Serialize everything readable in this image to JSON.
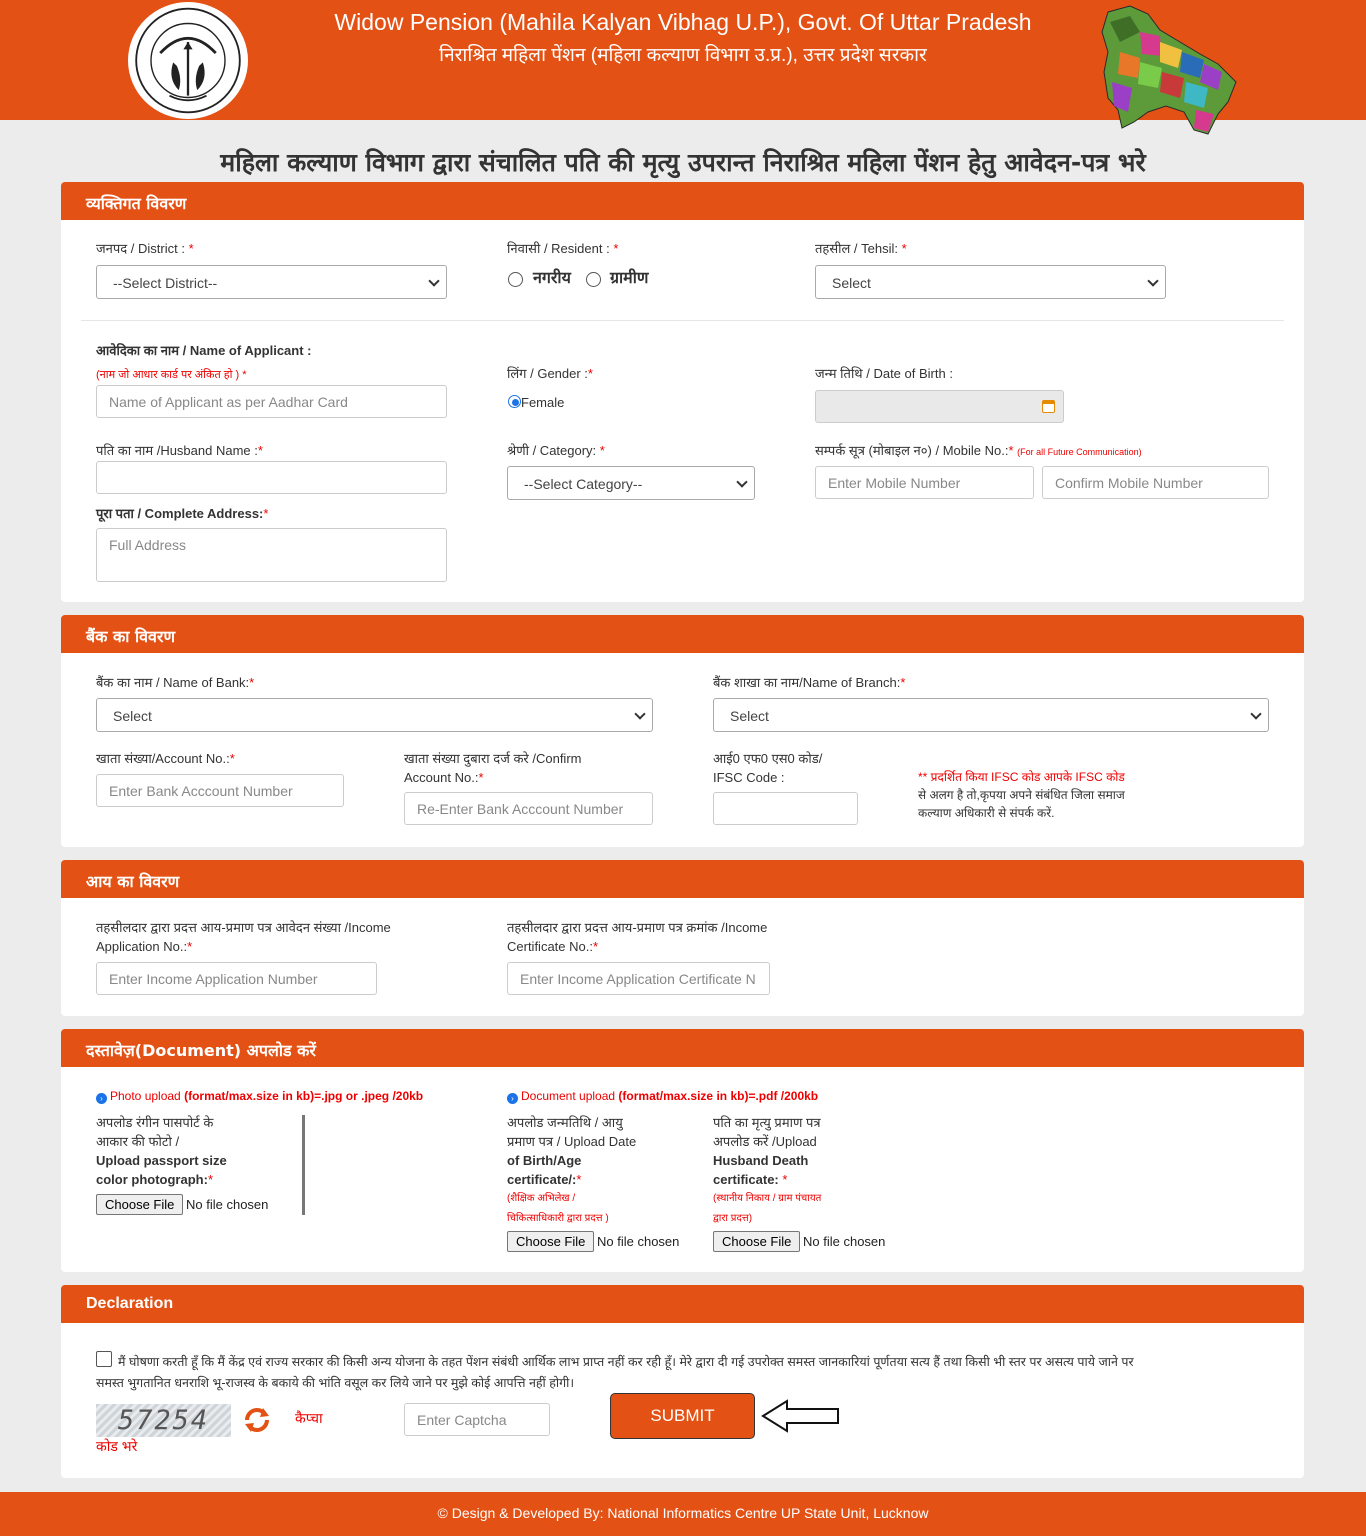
{
  "header": {
    "title_en": "Widow Pension (Mahila Kalyan Vibhag U.P.), Govt. Of Uttar Pradesh",
    "title_hi": "निराश्रित महिला पेंशन (महिला कल्याण विभाग उ.प्र.), उत्तर प्रदेश सरकार",
    "seal_text": "उत्तर प्रदेश सरकार"
  },
  "page_heading": "महिला कल्याण विभाग द्वारा संचालित पति की मृत्यु उपरान्त निराश्रित महिला पेंशन हेतु आवेदन-पत्र भरे",
  "personal": {
    "heading": "व्यक्तिगत विवरण",
    "district_label": "जनपद / District :",
    "district_value": "--Select District--",
    "resident_label": "निवासी / Resident :",
    "resident_urban": "नगरीय",
    "resident_rural": "ग्रामीण",
    "tehsil_label": "तहसील / Tehsil:",
    "tehsil_value": "Select",
    "applicant_label": "आवेदिका का नाम / Name of Applicant :",
    "applicant_note": "(नाम जो आधार कार्ड पर अंकित हो )",
    "applicant_placeholder": "Name of Applicant as per Aadhar Card",
    "gender_label": "लिंग / Gender :",
    "gender_female": "Female",
    "dob_label": "जन्म तिथि / Date of Birth :",
    "husband_label": "पति का नाम /Husband Name :",
    "category_label": "श्रेणी / Category:",
    "category_value": "--Select Category--",
    "mobile_label": "सम्पर्क सूत्र (मोबाइल न०) / Mobile No.:",
    "mobile_note": "(For all Future Communication)",
    "mobile_placeholder": "Enter Mobile Number",
    "mobile_confirm_placeholder": "Confirm Mobile Number",
    "address_label": "पूरा पता / Complete Address:",
    "address_placeholder": "Full Address"
  },
  "bank": {
    "heading": "बैंक का विवरण",
    "bank_label": "बैंक का नाम / Name of Bank:",
    "bank_value": "Select",
    "branch_label": "बैंक शाखा का नाम/Name of Branch:",
    "branch_value": "Select",
    "account_label": "खाता संख्या/Account No.:",
    "account_placeholder": "Enter Bank Acccount Number",
    "confirm_label_1": "खाता संख्या दुबारा दर्ज करे /Confirm",
    "confirm_label_2": "Account No.:",
    "confirm_placeholder": "Re-Enter Bank Acccount Number",
    "ifsc_label_1": "आई0 एफ0 एस0 कोड/",
    "ifsc_label_2": "IFSC Code :",
    "ifsc_note_1": "** प्रदर्शित किया IFSC कोड आपके IFSC कोड",
    "ifsc_note_2": "से अलग है तो,कृपया अपने संबंधित जिला समाज",
    "ifsc_note_3": "कल्याण अधिकारी से संपर्क करें."
  },
  "income": {
    "heading": "आय का विवरण",
    "app_label_1": "तहसीलदार द्वारा प्रदत्त आय-प्रमाण पत्र आवेदन संख्या /Income",
    "app_label_2": "Application No.:",
    "app_placeholder": "Enter Income Application Number",
    "cert_label_1": "तहसीलदार द्वारा प्रदत्त आय-प्रमाण पत्र क्रमांक /Income",
    "cert_label_2": "Certificate No.:",
    "cert_placeholder": "Enter Income Application Certificate N"
  },
  "documents": {
    "heading": "दस्तावेज़(Document) अपलोड करें",
    "photo_info_a": "Photo upload",
    "photo_info_b": "(format/max.size in kb)=.jpg or .jpeg /20kb",
    "doc_info_a": "Document upload",
    "doc_info_b": "(format/max.size in kb)=.pdf /200kb",
    "photo_label_1": "अपलोड रंगीन पासपोर्ट के",
    "photo_label_2": "आकार की फोटो /",
    "photo_label_3": "Upload passport size",
    "photo_label_4": "color photograph:",
    "dob_label_1": "अपलोड जन्मतिथि / आयु",
    "dob_label_2": "प्रमाण पत्र / Upload Date",
    "dob_label_3": "of Birth/Age",
    "dob_label_4": "certificate/:",
    "dob_note_1": "(शैक्षिक अभिलेख /",
    "dob_note_2": "चिकित्साधिकारी द्वारा प्रदत्त )",
    "death_label_1": "पति का मृत्यु प्रमाण पत्र",
    "death_label_2": "अपलोड करें /Upload",
    "death_label_3": "Husband Death",
    "death_label_4": "certificate:",
    "death_note_1": "(स्थानीय निकाय / ग्राम पंचायत",
    "death_note_2": "द्वारा प्रदत्त)",
    "choose_file": "Choose File",
    "no_file": "No file chosen"
  },
  "declaration": {
    "heading": "Declaration",
    "text_1": "मैं घोषणा करती हूँ कि मैं केंद्र एवं राज्य सरकार की किसी अन्य योजना के तहत पेंशन संबंधी आर्थिक लाभ प्राप्त नहीं कर रही हूँ। मेरे द्वारा दी गई उपरोक्त समस्त जानकारियां पूर्णतया सत्य हैं तथा किसी भी स्तर पर असत्य पाये जाने पर",
    "text_2": "समस्त भुगतानित धनराशि भू-राजस्व के बकाये की भांति वसूल कर लिये जाने पर मुझे कोई आपत्ति नहीं होगी।",
    "captcha_code": "57254",
    "captcha_label_1": "कैप्चा",
    "captcha_label_2": "कोड भरे",
    "captcha_placeholder": "Enter Captcha",
    "submit": "SUBMIT"
  },
  "footer": "© Design & Developed By: National Informatics Centre UP State Unit, Lucknow",
  "colors": {
    "brand": "#e45114",
    "required": "#e00000",
    "info": "#1a73e8"
  }
}
